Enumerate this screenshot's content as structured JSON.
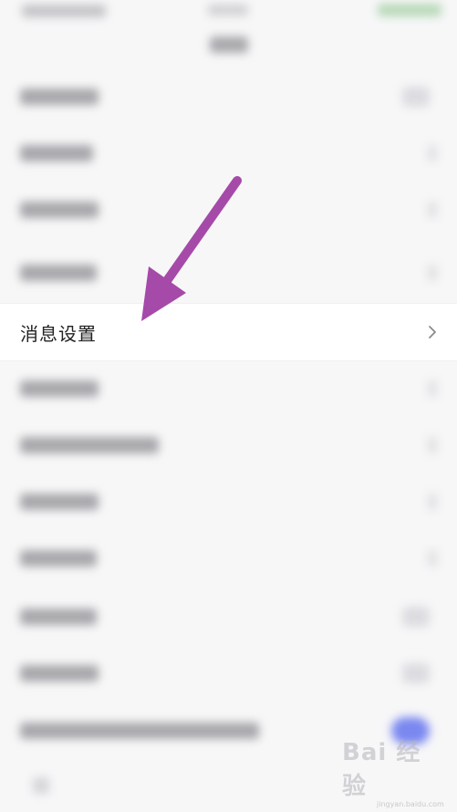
{
  "highlight": {
    "label": "消息设置"
  },
  "watermark": {
    "text": "Bai 经验",
    "url": "jingyan.baidu.com"
  },
  "colors": {
    "arrow": "#a54aa8",
    "background": "#f7f7f8",
    "row": "#ffffff"
  },
  "icons": {
    "chevron": "chevron-right-icon",
    "arrow": "annotation-arrow-icon"
  }
}
